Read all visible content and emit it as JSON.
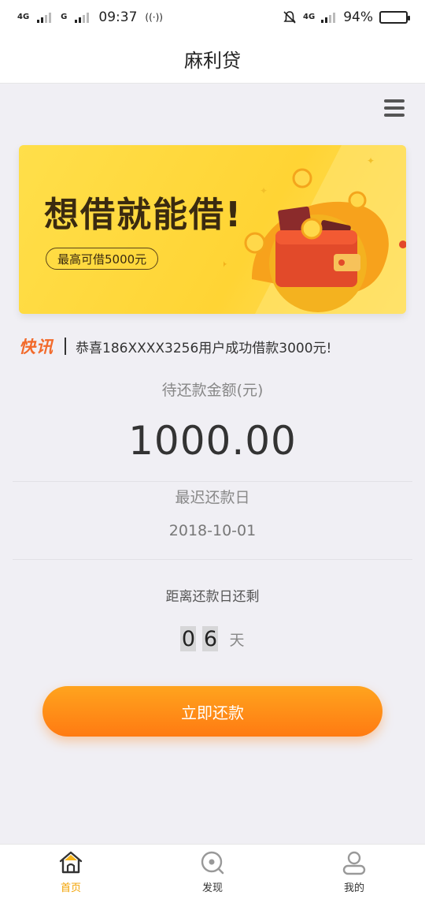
{
  "status_bar": {
    "network_1": "4G",
    "network_2": "G",
    "time": "09:37",
    "network_right": "4G",
    "battery": "94%"
  },
  "app": {
    "title": "麻利贷"
  },
  "banner": {
    "slogan": "想借就能借!",
    "pill": "最高可借5000元"
  },
  "ticker": {
    "badge": "快讯",
    "message": "恭喜186XXXX3256用户成功借款3000元!"
  },
  "repayment": {
    "amount_label": "待还款金额(元)",
    "amount": "1000.00",
    "due_label": "最迟还款日",
    "due_date": "2018-10-01",
    "remaining_label": "距离还款日还剩",
    "days_digit_1": "0",
    "days_digit_2": "6",
    "days_unit": "天",
    "button_label": "立即还款"
  },
  "tabs": [
    {
      "label": "首页",
      "icon": "home-icon",
      "active": true
    },
    {
      "label": "发现",
      "icon": "discover-icon",
      "active": false
    },
    {
      "label": "我的",
      "icon": "profile-icon",
      "active": false
    }
  ],
  "colors": {
    "accent": "#ff8a16",
    "tab_active": "#f2a200",
    "ticker_badge": "#f26a2b",
    "banner_bg": "#ffd434"
  }
}
